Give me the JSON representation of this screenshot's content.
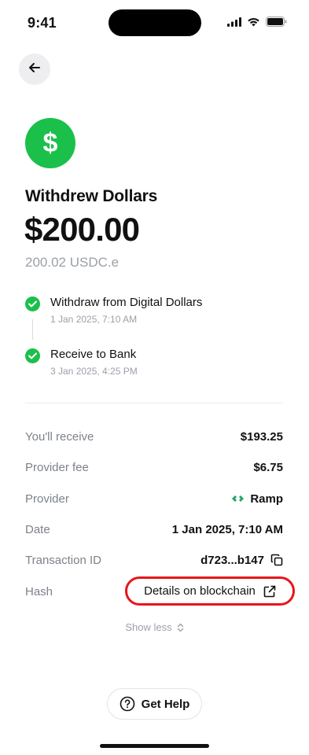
{
  "status_bar": {
    "time": "9:41"
  },
  "header": {
    "back_icon": "arrow-left-icon"
  },
  "hero": {
    "badge_symbol": "$",
    "badge_color": "#1bc04a",
    "title": "Withdrew Dollars",
    "amount": "$200.00",
    "sub_amount": "200.02 USDC.e"
  },
  "steps": [
    {
      "title": "Withdraw from Digital Dollars",
      "time": "1 Jan 2025, 7:10 AM",
      "status": "complete"
    },
    {
      "title": "Receive to Bank",
      "time": "3 Jan 2025, 4:25 PM",
      "status": "complete"
    }
  ],
  "details": {
    "receive": {
      "label": "You'll receive",
      "value": "$193.25"
    },
    "fee": {
      "label": "Provider fee",
      "value": "$6.75"
    },
    "provider": {
      "label": "Provider",
      "value": "Ramp",
      "icon": "ramp-logo-icon"
    },
    "date": {
      "label": "Date",
      "value": "1 Jan 2025, 7:10 AM"
    },
    "txid": {
      "label": "Transaction ID",
      "value": "d723...b147",
      "icon": "copy-icon"
    },
    "hash": {
      "label": "Hash",
      "value": "Details on blockchain",
      "icon": "external-link-icon"
    }
  },
  "show_less": {
    "label": "Show less",
    "icon": "chevron-up-down-icon"
  },
  "help": {
    "label": "Get Help",
    "icon": "help-circle-icon"
  },
  "colors": {
    "accent_green": "#1bc04a",
    "highlight_red": "#e8151c",
    "muted_text": "#9ba0a8"
  }
}
